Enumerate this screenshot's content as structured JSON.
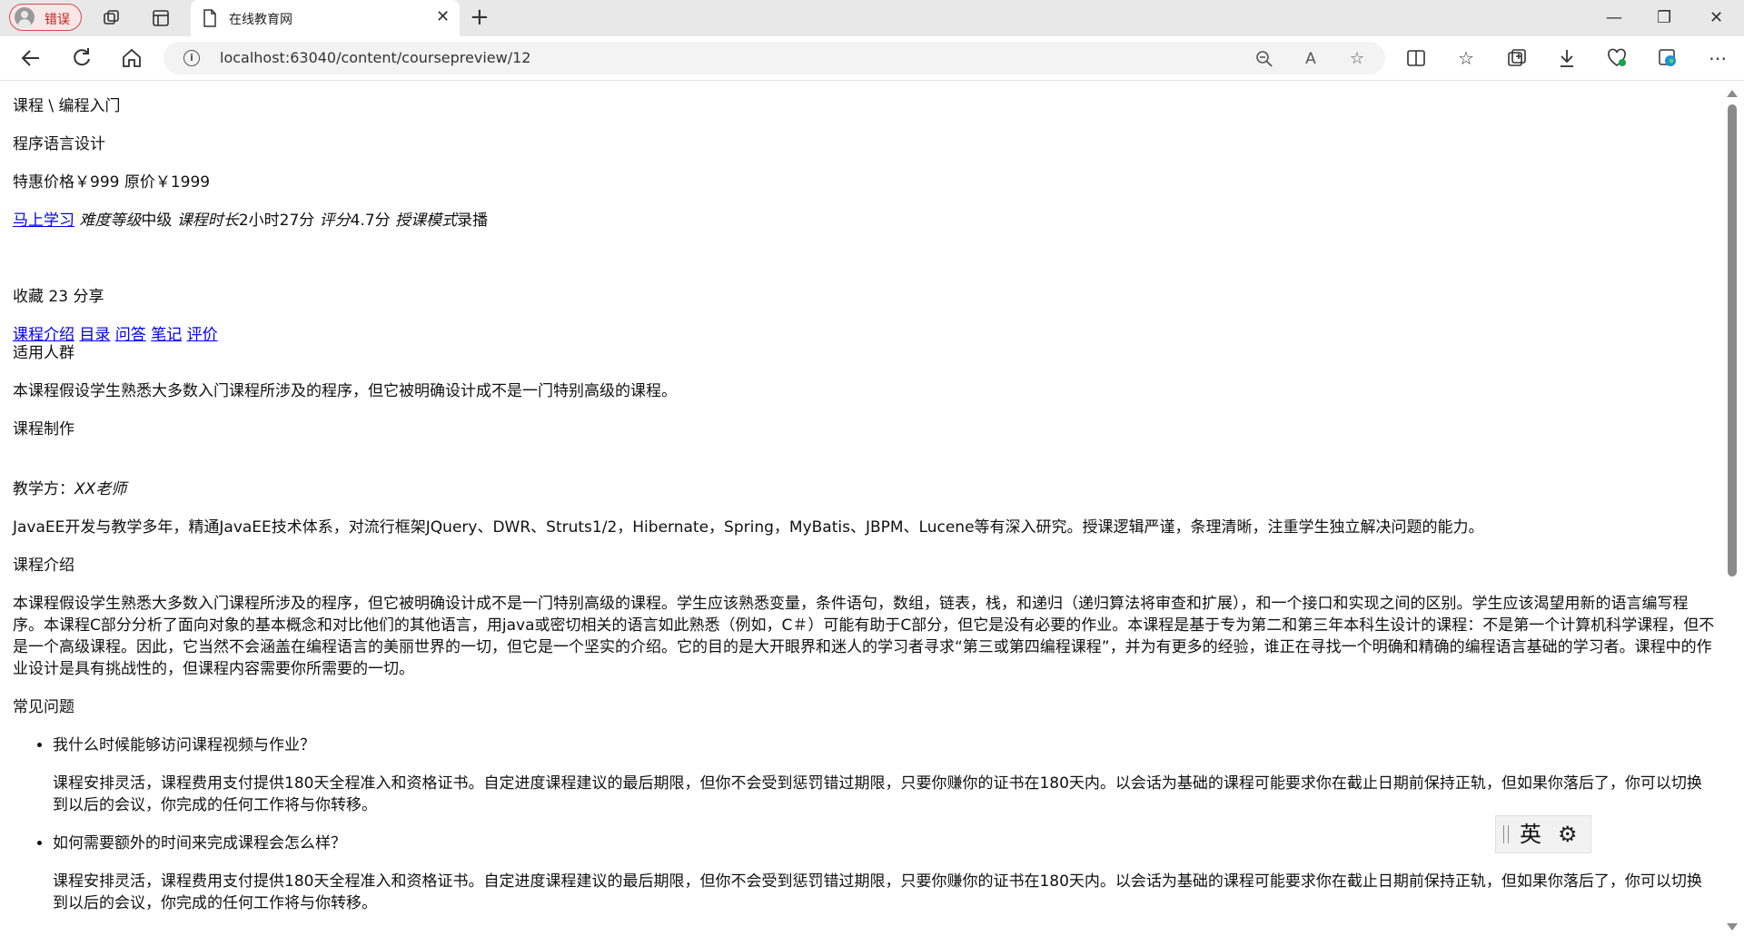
{
  "browser": {
    "profile_label": "错误",
    "tab_title": "在线教育网",
    "url": "localhost:63040/content/coursepreview/12",
    "icons": {
      "back": "arrow-left-icon",
      "reload": "reload-icon",
      "home": "home-icon",
      "info": "info-icon",
      "zoom": "zoom-out-icon",
      "read_aloud": "read-aloud-icon",
      "favorite": "star-icon",
      "split": "split-screen-icon",
      "favorites": "favorites-icon",
      "collections": "collections-icon",
      "download": "download-icon",
      "health": "browser-essentials-icon",
      "edge": "edge-icon",
      "more": "more-icon"
    }
  },
  "page": {
    "breadcrumb": "课程 \\ 编程入门",
    "course_title": "程序语言设计",
    "price_line": "特惠价格￥999 原价￥1999",
    "learn_now": "马上学习",
    "meta": {
      "difficulty_label": "难度等级",
      "difficulty_value": "中级",
      "duration_label": "课程时长",
      "duration_value": "2小时27分",
      "rating_label": "评分",
      "rating_value": "4.7分",
      "mode_label": "授课模式",
      "mode_value": "录播"
    },
    "collect_share": "收藏 23 分享",
    "tabs": [
      {
        "label": "课程介绍"
      },
      {
        "label": "目录"
      },
      {
        "label": "问答"
      },
      {
        "label": "笔记"
      },
      {
        "label": "评价"
      }
    ],
    "audience_heading": "适用人群",
    "audience_text": "本课程假设学生熟悉大多数入门课程所涉及的程序，但它被明确设计成不是一门特别高级的课程。",
    "production_heading": "课程制作",
    "teacher_label": "教学方：",
    "teacher_name": "XX老师",
    "teacher_bio": "JavaEE开发与教学多年，精通JavaEE技术体系，对流行框架JQuery、DWR、Struts1/2，Hibernate，Spring，MyBatis、JBPM、Lucene等有深入研究。授课逻辑严谨，条理清晰，注重学生独立解决问题的能力。",
    "intro_heading": "课程介绍",
    "intro_text": "本课程假设学生熟悉大多数入门课程所涉及的程序，但它被明确设计成不是一门特别高级的课程。学生应该熟悉变量，条件语句，数组，链表，栈，和递归（递归算法将审查和扩展），和一个接口和实现之间的区别。学生应该渴望用新的语言编写程序。本课程C部分分析了面向对象的基本概念和对比他们的其他语言，用java或密切相关的语言如此熟悉（例如，C＃）可能有助于C部分，但它是没有必要的作业。本课程是基于专为第二和第三年本科生设计的课程：不是第一个计算机科学课程，但不是一个高级课程。因此，它当然不会涵盖在编程语言的美丽世界的一切，但它是一个坚实的介绍。它的目的是大开眼界和迷人的学习者寻求“第三或第四编程课程”，并为有更多的经验，谁正在寻找一个明确和精确的编程语言基础的学习者。课程中的作业设计是具有挑战性的，但课程内容需要你所需要的一切。",
    "faq_heading": "常见问题",
    "faq": [
      {
        "q": "我什么时候能够访问课程视频与作业？",
        "a": "课程安排灵活，课程费用支付提供180天全程准入和资格证书。自定进度课程建议的最后期限，但你不会受到惩罚错过期限，只要你赚你的证书在180天内。以会话为基础的课程可能要求你在截止日期前保持正轨，但如果你落后了，你可以切换到以后的会议，你完成的任何工作将与你转移。"
      },
      {
        "q": "如何需要额外的时间来完成课程会怎么样？",
        "a": "课程安排灵活，课程费用支付提供180天全程准入和资格证书。自定进度课程建议的最后期限，但你不会受到惩罚错过期限，只要你赚你的证书在180天内。以会话为基础的课程可能要求你在截止日期前保持正轨，但如果你落后了，你可以切换到以后的会议，你完成的任何工作将与你转移。"
      }
    ]
  },
  "ime": {
    "language": "英",
    "icons": {
      "grip": "ime-grip-icon",
      "settings": "gear-icon"
    }
  },
  "colors": {
    "link": "#0000ee",
    "tabbar_bg": "#e8e8e8",
    "profile_error": "#c21f1f"
  }
}
